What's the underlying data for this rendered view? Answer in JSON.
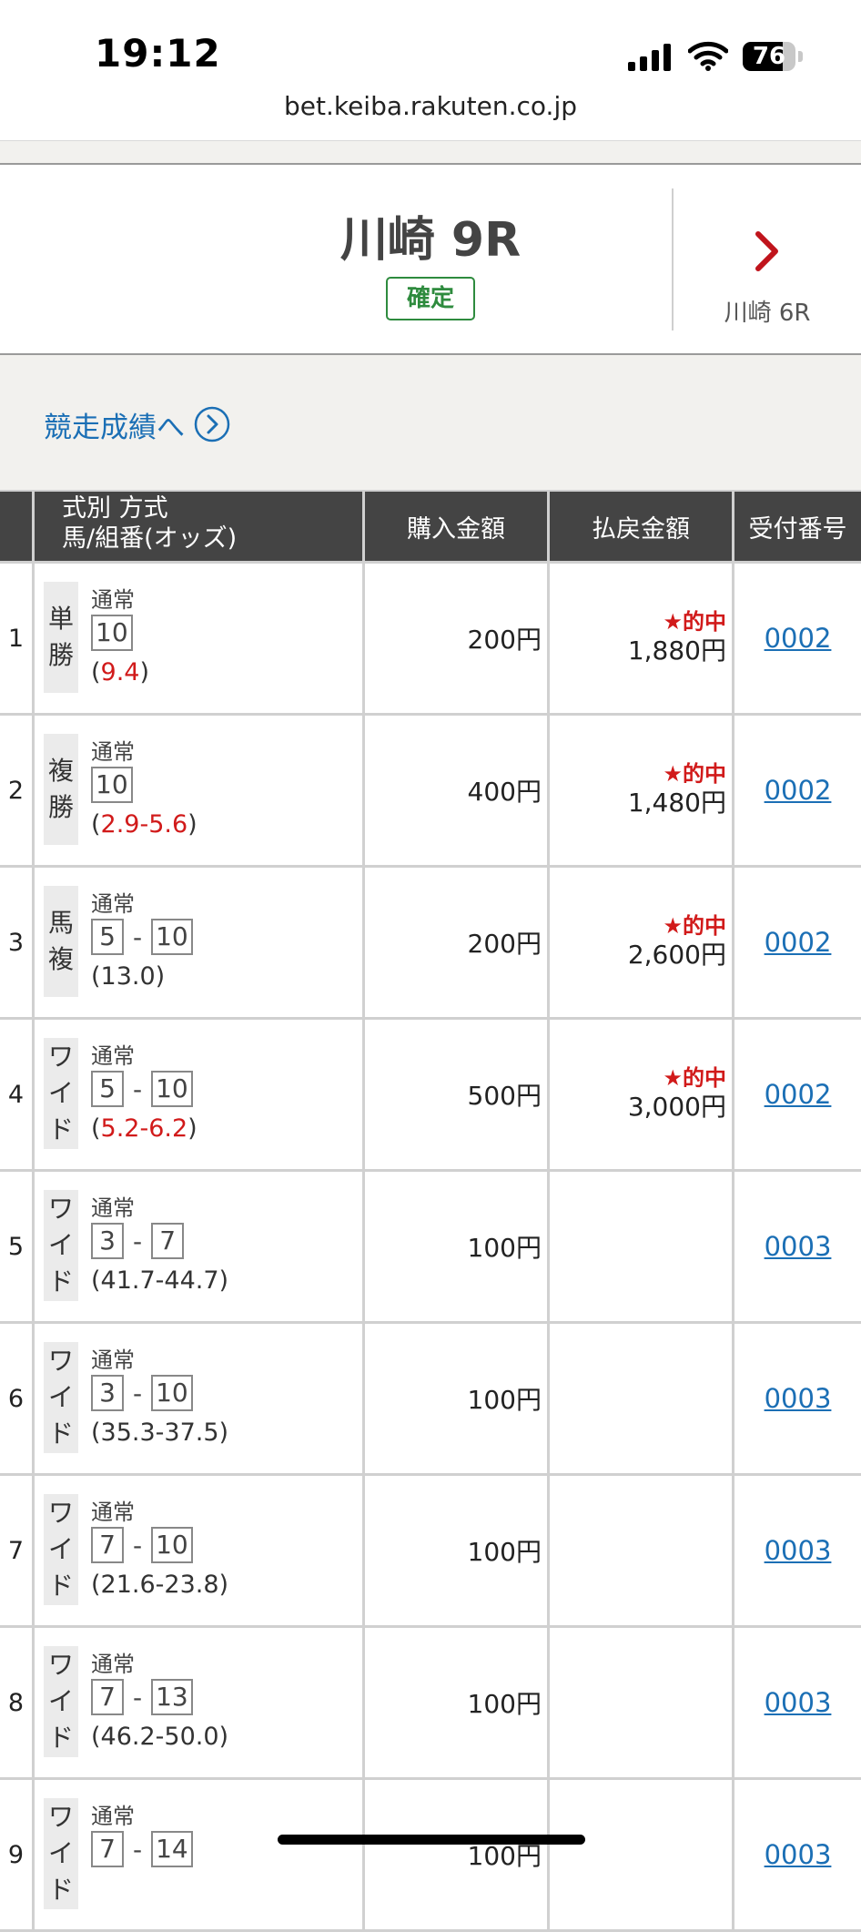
{
  "status_bar": {
    "time": "19:12",
    "battery": "76",
    "battery_level": 0.76
  },
  "browser": {
    "url": "bet.keiba.rakuten.co.jp"
  },
  "race": {
    "title": "川崎 9R",
    "status": "確定",
    "next_label": "川崎 6R"
  },
  "results_link": "競走成績へ",
  "table": {
    "headers": {
      "index": "",
      "type_line1": "式別 方式",
      "type_line2": "馬/組番(オッズ)",
      "amount": "購入金額",
      "payout": "払戻金額",
      "receipt": "受付番号"
    },
    "rows": [
      {
        "no": "1",
        "type_chars": [
          "単",
          "勝"
        ],
        "method": "通常",
        "horses": [
          "10"
        ],
        "odds_open": "(",
        "odds": "9.4",
        "odds_close": ")",
        "odds_red": true,
        "amount": "200円",
        "hit": "★的中",
        "payout": "1,880円",
        "receipt": "0002"
      },
      {
        "no": "2",
        "type_chars": [
          "複",
          "勝"
        ],
        "method": "通常",
        "horses": [
          "10"
        ],
        "odds_open": "(",
        "odds": "2.9-5.6",
        "odds_close": ")",
        "odds_red": true,
        "amount": "400円",
        "hit": "★的中",
        "payout": "1,480円",
        "receipt": "0002"
      },
      {
        "no": "3",
        "type_chars": [
          "馬",
          "複"
        ],
        "method": "通常",
        "horses": [
          "5",
          "10"
        ],
        "odds_open": "(",
        "odds": "13.0",
        "odds_close": ")",
        "odds_red": false,
        "amount": "200円",
        "hit": "★的中",
        "payout": "2,600円",
        "receipt": "0002"
      },
      {
        "no": "4",
        "type_chars": [
          "ワ",
          "イ",
          "ド"
        ],
        "method": "通常",
        "horses": [
          "5",
          "10"
        ],
        "odds_open": "(",
        "odds": "5.2-6.2",
        "odds_close": ")",
        "odds_red": true,
        "amount": "500円",
        "hit": "★的中",
        "payout": "3,000円",
        "receipt": "0002"
      },
      {
        "no": "5",
        "type_chars": [
          "ワ",
          "イ",
          "ド"
        ],
        "method": "通常",
        "horses": [
          "3",
          "7"
        ],
        "odds_open": "(",
        "odds": "41.7-44.7",
        "odds_close": ")",
        "odds_red": false,
        "amount": "100円",
        "hit": "",
        "payout": "",
        "receipt": "0003"
      },
      {
        "no": "6",
        "type_chars": [
          "ワ",
          "イ",
          "ド"
        ],
        "method": "通常",
        "horses": [
          "3",
          "10"
        ],
        "odds_open": "(",
        "odds": "35.3-37.5",
        "odds_close": ")",
        "odds_red": false,
        "amount": "100円",
        "hit": "",
        "payout": "",
        "receipt": "0003"
      },
      {
        "no": "7",
        "type_chars": [
          "ワ",
          "イ",
          "ド"
        ],
        "method": "通常",
        "horses": [
          "7",
          "10"
        ],
        "odds_open": "(",
        "odds": "21.6-23.8",
        "odds_close": ")",
        "odds_red": false,
        "amount": "100円",
        "hit": "",
        "payout": "",
        "receipt": "0003"
      },
      {
        "no": "8",
        "type_chars": [
          "ワ",
          "イ",
          "ド"
        ],
        "method": "通常",
        "horses": [
          "7",
          "13"
        ],
        "odds_open": "(",
        "odds": "46.2-50.0",
        "odds_close": ")",
        "odds_red": false,
        "amount": "100円",
        "hit": "",
        "payout": "",
        "receipt": "0003"
      },
      {
        "no": "9",
        "type_chars": [
          "ワ",
          "イ",
          "ド"
        ],
        "method": "通常",
        "horses": [
          "7",
          "14"
        ],
        "odds_open": "",
        "odds": "",
        "odds_close": "",
        "odds_red": false,
        "amount": "100円",
        "hit": "",
        "payout": "",
        "receipt": "0003"
      }
    ]
  },
  "icons": {
    "signal": "signal-icon",
    "wifi": "wifi-icon",
    "battery": "battery-icon",
    "next": "chevron-right-icon",
    "results": "circle-chevron-right-icon"
  },
  "colors": {
    "accent_link": "#1b6fb5",
    "hit_red": "#d11a1a",
    "confirmed_green": "#2e8b3e",
    "table_header": "#444444",
    "section_bg": "#f2f1ee"
  }
}
